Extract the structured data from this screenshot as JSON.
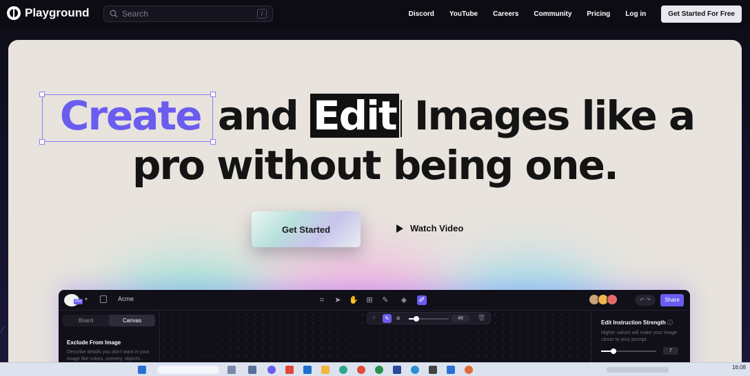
{
  "nav": {
    "brand": "Playground",
    "search_placeholder": "Search",
    "search_shortcut": "/",
    "links": [
      "Discord",
      "YouTube",
      "Careers",
      "Community",
      "Pricing",
      "Log in"
    ],
    "cta": "Get Started For Free"
  },
  "hero": {
    "word_create": "Create",
    "word_and": "and",
    "word_edit": "Edit",
    "line1_rest": "Images like a",
    "line2": "pro without being one.",
    "primary_button": "Get Started",
    "secondary_button": "Watch Video",
    "accent_color": "#6b5cf0"
  },
  "app_preview": {
    "project_name": "Acme",
    "plan_badge": "Pro",
    "share_button": "Share",
    "left_tabs": [
      "Board",
      "Canvas"
    ],
    "active_tab": "Canvas",
    "left_title": "Exclude From Image",
    "left_desc": "Describe details you don't want in your image like colors, scenery, objects...",
    "brush_size": "48",
    "right_title": "Edit Instruction Strength",
    "right_desc": "Higher values will make your image closer to your prompt",
    "strength_value": "7"
  },
  "taskbar": {
    "time": "16:08"
  }
}
